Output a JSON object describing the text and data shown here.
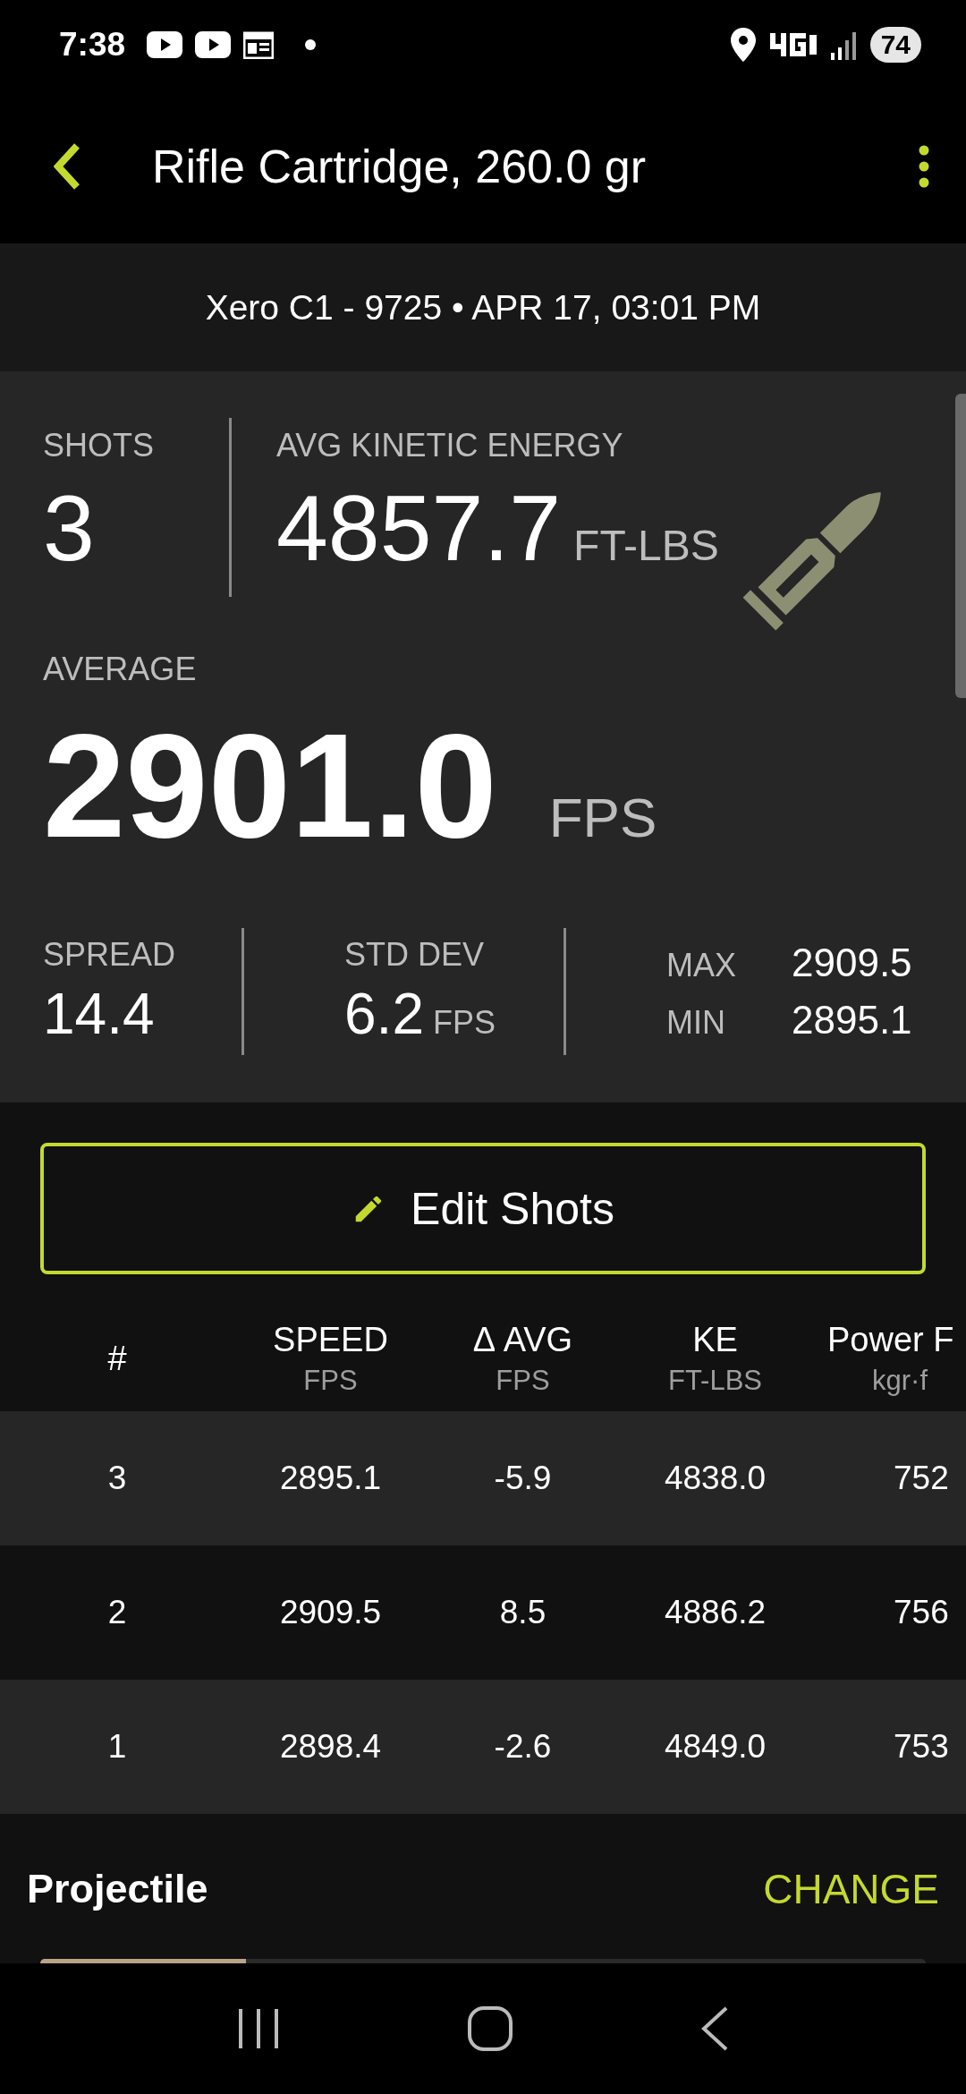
{
  "status_bar": {
    "time": "7:38",
    "battery": "74"
  },
  "app_bar": {
    "title": "Rifle Cartridge, 260.0 gr"
  },
  "device_line": "Xero C1 - 9725 • APR 17, 03:01 PM",
  "summary": {
    "shots": {
      "label": "SHOTS",
      "value": "3"
    },
    "energy": {
      "label": "AVG KINETIC ENERGY",
      "value": "4857.7",
      "unit": "FT-LBS"
    },
    "average": {
      "label": "AVERAGE",
      "value": "2901.0",
      "unit": "FPS"
    },
    "spread": {
      "label": "SPREAD",
      "value": "14.4"
    },
    "std_dev": {
      "label": "STD DEV",
      "value": "6.2",
      "unit": "FPS"
    },
    "extremes": [
      {
        "label": "MAX",
        "value": "2909.5"
      },
      {
        "label": "MIN",
        "value": "2895.1"
      }
    ]
  },
  "edit_button": "Edit Shots",
  "table": {
    "columns": [
      {
        "title": "#"
      },
      {
        "title": "SPEED",
        "unit": "FPS"
      },
      {
        "title": "Δ AVG",
        "unit": "FPS"
      },
      {
        "title": "KE",
        "unit": "FT-LBS"
      },
      {
        "title": "Power F",
        "unit": "kgr·f"
      }
    ],
    "rows": [
      [
        "3",
        "2895.1",
        "-5.9",
        "4838.0",
        "752"
      ],
      [
        "2",
        "2909.5",
        "8.5",
        "4886.2",
        "756"
      ],
      [
        "1",
        "2898.4",
        "-2.6",
        "4849.0",
        "753"
      ]
    ]
  },
  "projectile": {
    "title": "Projectile",
    "action": "CHANGE"
  }
}
